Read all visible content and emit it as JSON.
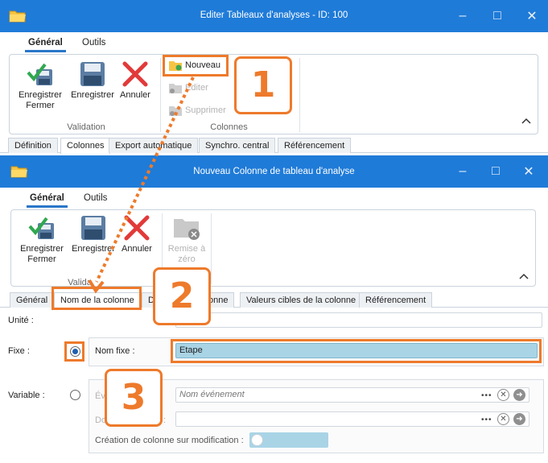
{
  "colors": {
    "accent": "#1f7bd8",
    "highlight": "#ee7a2b",
    "selected_field": "#a9d4e6"
  },
  "window1": {
    "title": "Editer Tableaux d'analyses - ID: 100",
    "menu_tabs": [
      "Général",
      "Outils"
    ],
    "ribbon": {
      "save_close": "Enregistrer Fermer",
      "save": "Enregistrer",
      "cancel": "Annuler",
      "group_validation": "Validation",
      "new": "Nouveau",
      "edit": "Editer",
      "delete": "Supprimer",
      "group_columns": "Colonnes"
    },
    "tabs": [
      "Définition",
      "Colonnes",
      "Export automatique",
      "Synchro. central",
      "Référencement"
    ],
    "active_tab": "Colonnes"
  },
  "window2": {
    "title": "Nouveau Colonne de tableau d'analyse",
    "menu_tabs": [
      "Général",
      "Outils"
    ],
    "ribbon": {
      "save_close": "Enregistrer Fermer",
      "save": "Enregistrer",
      "cancel": "Annuler",
      "group_validation": "Valida",
      "reset": "Remise à zéro"
    },
    "tabs": [
      "Général",
      "Nom de la colonne",
      "Do",
      "onne",
      "Valeurs cibles de la colonne",
      "Référencement"
    ],
    "active_tab": "Nom de la colonne",
    "form": {
      "unit_label": "Unité :",
      "fixed_label": "Fixe :",
      "fixed_name_label": "Nom fixe :",
      "fixed_name_value": "Etape",
      "variable_label": "Variable :",
      "event_label": "Év",
      "event_placeholder": "Nom événement",
      "second_label": "Do",
      "second_tail": ":",
      "create_on_modify_label": "Création de colonne sur modification :",
      "dots": "•••"
    }
  },
  "callouts": [
    "1",
    "2",
    "3"
  ]
}
